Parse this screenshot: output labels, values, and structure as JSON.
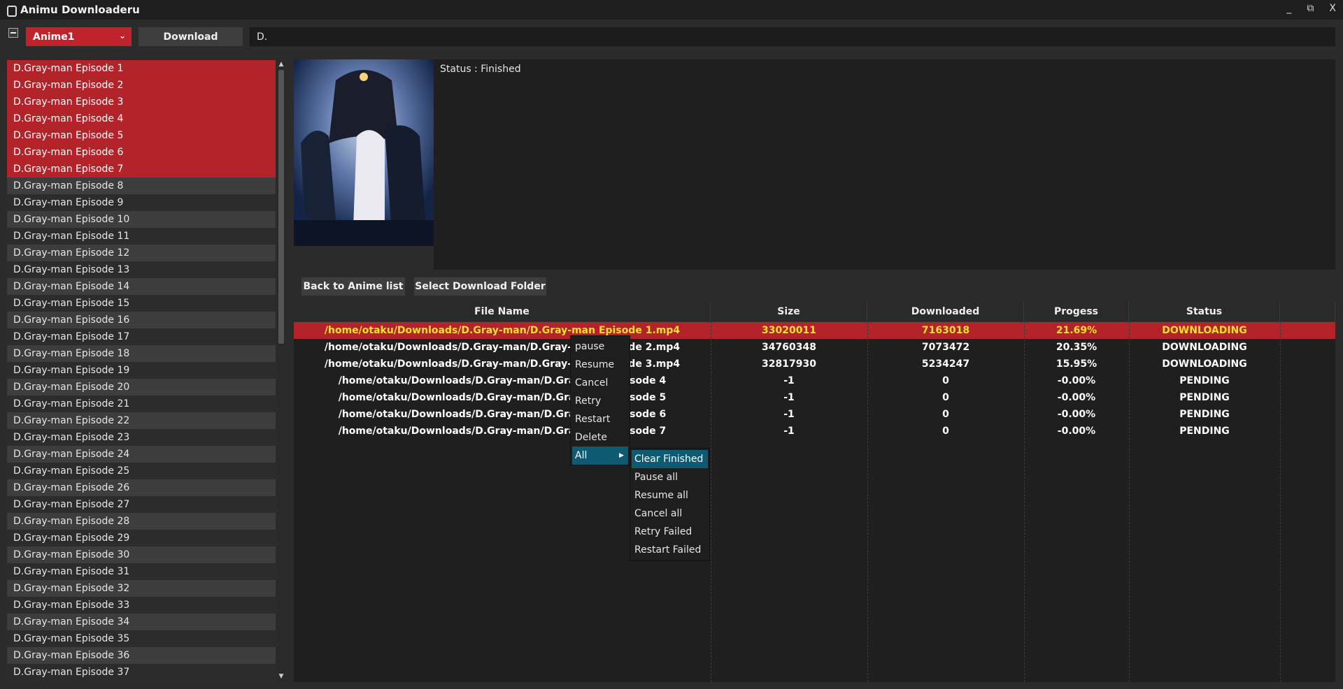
{
  "window": {
    "title": "Animu Downloaderu",
    "minimize": "_",
    "restore": "⧉",
    "close": "X"
  },
  "toolbar": {
    "source": "Anime1",
    "download_label": "Download",
    "search_value": "D."
  },
  "episodes": [
    "D.Gray-man Episode 1",
    "D.Gray-man Episode 2",
    "D.Gray-man Episode 3",
    "D.Gray-man Episode 4",
    "D.Gray-man Episode 5",
    "D.Gray-man Episode 6",
    "D.Gray-man Episode 7",
    "D.Gray-man Episode 8",
    "D.Gray-man Episode 9",
    "D.Gray-man Episode 10",
    "D.Gray-man Episode 11",
    "D.Gray-man Episode 12",
    "D.Gray-man Episode 13",
    "D.Gray-man Episode 14",
    "D.Gray-man Episode 15",
    "D.Gray-man Episode 16",
    "D.Gray-man Episode 17",
    "D.Gray-man Episode 18",
    "D.Gray-man Episode 19",
    "D.Gray-man Episode 20",
    "D.Gray-man Episode 21",
    "D.Gray-man Episode 22",
    "D.Gray-man Episode 23",
    "D.Gray-man Episode 24",
    "D.Gray-man Episode 25",
    "D.Gray-man Episode 26",
    "D.Gray-man Episode 27",
    "D.Gray-man Episode 28",
    "D.Gray-man Episode 29",
    "D.Gray-man Episode 30",
    "D.Gray-man Episode 31",
    "D.Gray-man Episode 32",
    "D.Gray-man Episode 33",
    "D.Gray-man Episode 34",
    "D.Gray-man Episode 35",
    "D.Gray-man Episode 36",
    "D.Gray-man Episode 37"
  ],
  "selected_count": 7,
  "status_text": "Status : Finished",
  "buttons": {
    "back": "Back to Anime list",
    "folder": "Select Download Folder"
  },
  "table": {
    "headers": [
      "File Name",
      "Size",
      "Downloaded",
      "Progess",
      "Status"
    ],
    "rows": [
      [
        "/home/otaku/Downloads/D.Gray-man/D.Gray-man Episode 1.mp4",
        "33020011",
        "7163018",
        "21.69%",
        "DOWNLOADING"
      ],
      [
        "/home/otaku/Downloads/D.Gray-man/D.Gray-man Episode 2.mp4",
        "34760348",
        "7073472",
        "20.35%",
        "DOWNLOADING"
      ],
      [
        "/home/otaku/Downloads/D.Gray-man/D.Gray-man Episode 3.mp4",
        "32817930",
        "5234247",
        "15.95%",
        "DOWNLOADING"
      ],
      [
        "/home/otaku/Downloads/D.Gray-man/D.Gray-man Episode 4",
        "-1",
        "0",
        "-0.00%",
        "PENDING"
      ],
      [
        "/home/otaku/Downloads/D.Gray-man/D.Gray-man Episode 5",
        "-1",
        "0",
        "-0.00%",
        "PENDING"
      ],
      [
        "/home/otaku/Downloads/D.Gray-man/D.Gray-man Episode 6",
        "-1",
        "0",
        "-0.00%",
        "PENDING"
      ],
      [
        "/home/otaku/Downloads/D.Gray-man/D.Gray-man Episode 7",
        "-1",
        "0",
        "-0.00%",
        "PENDING"
      ]
    ]
  },
  "context_menu": {
    "items": [
      "pause",
      "Resume",
      "Cancel",
      "Retry",
      "Restart",
      "Delete",
      "All"
    ],
    "submenu": [
      "Clear Finished",
      "Pause all",
      "Resume all",
      "Cancel all",
      "Retry Failed",
      "Restart Failed"
    ]
  },
  "colors": {
    "accent": "#b3232a",
    "highlight_text": "#f2e12a",
    "menu_active": "#0f5a73"
  },
  "icons": {
    "app": "app-icon",
    "chevron": "chevron-down-icon",
    "collapse": "collapse-icon"
  }
}
